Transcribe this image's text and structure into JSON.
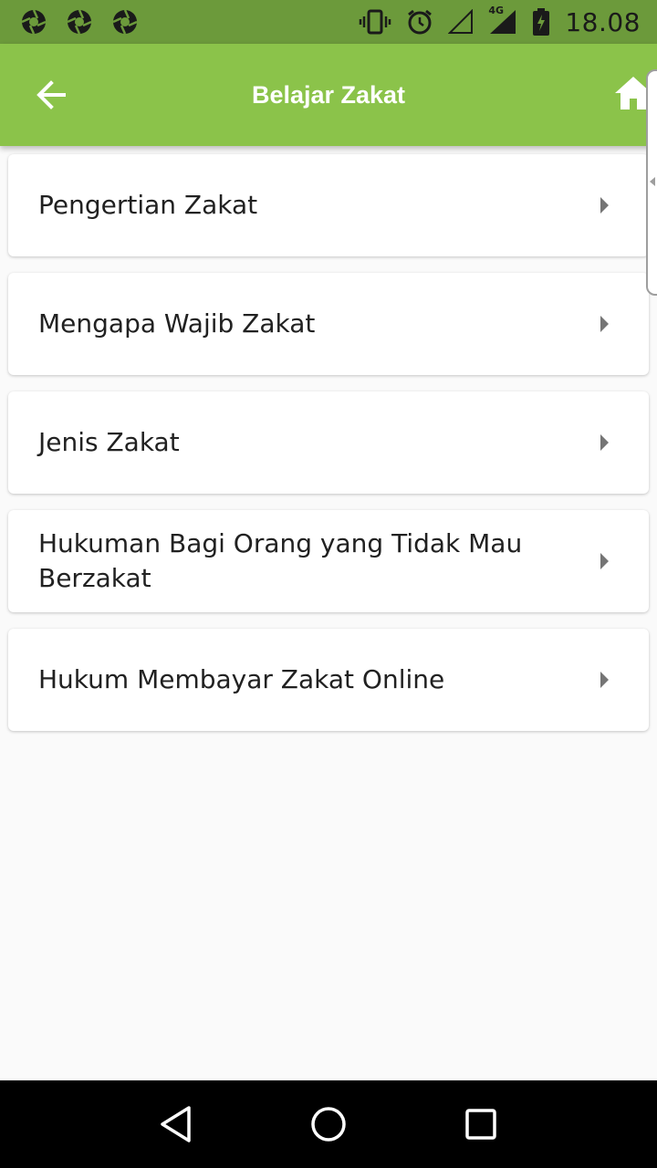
{
  "status_bar": {
    "time": "18.08",
    "network": "4G",
    "icons": [
      "aperture-icon",
      "aperture-icon",
      "aperture-icon",
      "vibrate-icon",
      "alarm-icon",
      "signal-empty-icon",
      "signal-4g-icon",
      "battery-charging-icon"
    ]
  },
  "app_bar": {
    "title": "Belajar Zakat",
    "back_icon": "arrow-left-icon",
    "home_icon": "home-icon",
    "color": "#8bc34a"
  },
  "menu": {
    "items": [
      {
        "label": "Pengertian Zakat"
      },
      {
        "label": "Mengapa Wajib Zakat"
      },
      {
        "label": "Jenis Zakat"
      },
      {
        "label": "Hukuman Bagi Orang yang Tidak Mau Berzakat"
      },
      {
        "label": "Hukum Membayar Zakat Online"
      }
    ]
  },
  "nav_bar": {
    "icons": [
      "back-triangle-icon",
      "home-circle-icon",
      "recents-square-icon"
    ]
  }
}
